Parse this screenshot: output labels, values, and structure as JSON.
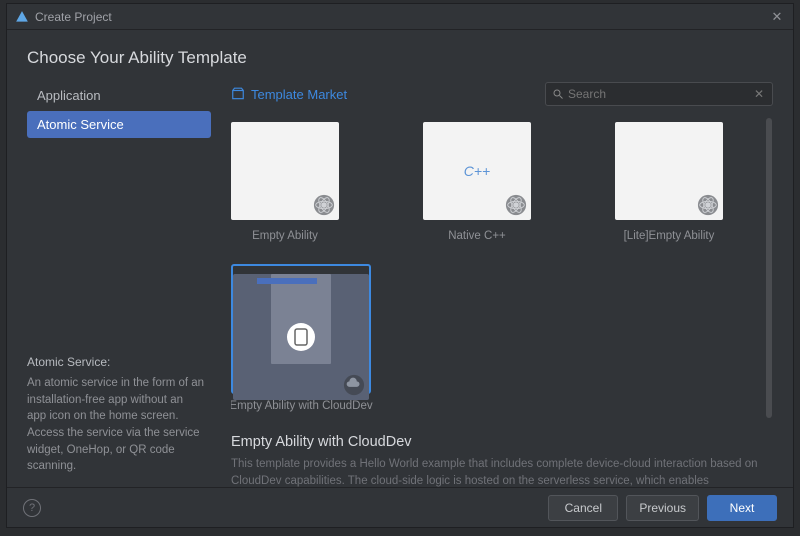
{
  "window": {
    "title": "Create Project"
  },
  "heading": "Choose Your Ability Template",
  "sidebar": {
    "items": [
      {
        "label": "Application",
        "selected": false
      },
      {
        "label": "Atomic Service",
        "selected": true
      }
    ],
    "description": {
      "title": "Atomic Service:",
      "body": "An atomic service in the form of an installation-free app without an app icon on the home screen. Access the service via the service widget, OneHop, or QR code scanning."
    }
  },
  "market_link": "Template Market",
  "search": {
    "placeholder": "Search",
    "value": ""
  },
  "templates": [
    {
      "id": "empty-ability",
      "label": "Empty Ability",
      "selected": false,
      "badge": "atom",
      "deco": "none"
    },
    {
      "id": "native-cpp",
      "label": "Native C++",
      "selected": false,
      "badge": "atom",
      "deco": "cpp"
    },
    {
      "id": "lite-empty-ability",
      "label": "[Lite]Empty Ability",
      "selected": false,
      "badge": "atom",
      "deco": "none"
    },
    {
      "id": "empty-ability-clouddev",
      "label": "Empty Ability with CloudDev",
      "selected": true,
      "badge": "cloud",
      "deco": "device"
    }
  ],
  "detail": {
    "title": "Empty Ability with CloudDev",
    "body": "This template provides a Hello World example that includes complete device-cloud interaction based on CloudDev capabilities. The cloud-side logic is hosted on the serverless service, which enables automatic scaling and O&M-free."
  },
  "footer": {
    "cancel": "Cancel",
    "previous": "Previous",
    "next": "Next"
  }
}
